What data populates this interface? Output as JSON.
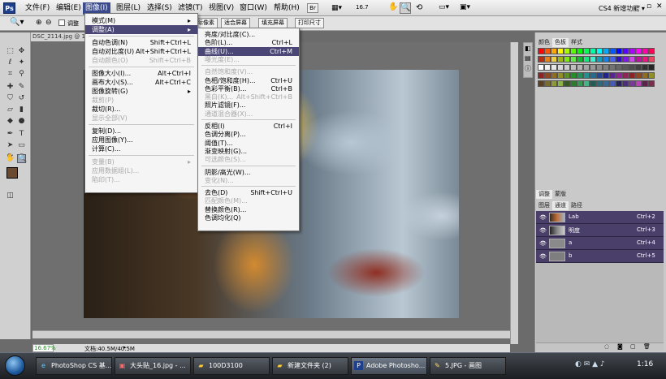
{
  "app": {
    "logo": "Ps",
    "workspace_label": "CS4 新增功能 ▾"
  },
  "menubar": {
    "items": [
      "文件(F)",
      "编辑(E)",
      "图像(I)",
      "图层(L)",
      "选择(S)",
      "滤镜(T)",
      "视图(V)",
      "窗口(W)",
      "帮助(H)"
    ],
    "zoom_readout": "16.7"
  },
  "options_bar": {
    "checkbox_label": "调整",
    "buttons": [
      "实际像素",
      "适合屏幕",
      "填充屏幕",
      "打印尺寸"
    ]
  },
  "document": {
    "tab_title": "DSC_2114.jpg @ 16.7%"
  },
  "status": {
    "zoom": "16.67%",
    "doc_size": "文档:40.5M/40.5M"
  },
  "image_menu": {
    "items": [
      {
        "label": "模式(M)",
        "arrow": "▸",
        "state": "normal"
      },
      {
        "label": "调整(A)",
        "arrow": "▸",
        "state": "highlight"
      },
      {
        "label": "自动色调(N)",
        "shortcut": "Shift+Ctrl+L",
        "state": "normal"
      },
      {
        "label": "自动对比度(U)",
        "shortcut": "Alt+Shift+Ctrl+L",
        "state": "normal"
      },
      {
        "label": "自动颜色(O)",
        "shortcut": "Shift+Ctrl+B",
        "state": "disabled"
      },
      {
        "label": "图像大小(I)...",
        "shortcut": "Alt+Ctrl+I",
        "state": "normal"
      },
      {
        "label": "画布大小(S)...",
        "shortcut": "Alt+Ctrl+C",
        "state": "normal"
      },
      {
        "label": "图像旋转(G)",
        "arrow": "▸",
        "state": "normal"
      },
      {
        "label": "裁剪(P)",
        "state": "disabled"
      },
      {
        "label": "裁切(R)...",
        "state": "normal"
      },
      {
        "label": "显示全部(V)",
        "state": "disabled"
      },
      {
        "label": "复制(D)...",
        "state": "normal"
      },
      {
        "label": "应用图像(Y)...",
        "state": "normal"
      },
      {
        "label": "计算(C)...",
        "state": "normal"
      },
      {
        "label": "变量(B)",
        "arrow": "▸",
        "state": "disabled"
      },
      {
        "label": "应用数据组(L)...",
        "state": "disabled"
      },
      {
        "label": "陷印(T)...",
        "state": "disabled"
      }
    ]
  },
  "adjust_menu": {
    "items": [
      {
        "label": "亮度/对比度(C)...",
        "state": "normal"
      },
      {
        "label": "色阶(L)...",
        "shortcut": "Ctrl+L",
        "state": "normal"
      },
      {
        "label": "曲线(U)...",
        "shortcut": "Ctrl+M",
        "state": "highlight"
      },
      {
        "label": "曝光度(E)...",
        "state": "disabled"
      },
      {
        "label": "自然饱和度(V)...",
        "state": "disabled"
      },
      {
        "label": "色相/饱和度(H)...",
        "shortcut": "Ctrl+U",
        "state": "normal"
      },
      {
        "label": "色彩平衡(B)...",
        "shortcut": "Ctrl+B",
        "state": "normal"
      },
      {
        "label": "黑白(K)...",
        "shortcut": "Alt+Shift+Ctrl+B",
        "state": "disabled"
      },
      {
        "label": "照片滤镜(F)...",
        "state": "normal"
      },
      {
        "label": "通道混合器(X)...",
        "state": "disabled"
      },
      {
        "label": "反相(I)",
        "shortcut": "Ctrl+I",
        "state": "normal"
      },
      {
        "label": "色调分离(P)...",
        "state": "normal"
      },
      {
        "label": "阈值(T)...",
        "state": "normal"
      },
      {
        "label": "渐变映射(G)...",
        "state": "normal"
      },
      {
        "label": "可选颜色(S)...",
        "state": "disabled"
      },
      {
        "label": "阴影/高光(W)...",
        "state": "normal"
      },
      {
        "label": "变化(N)...",
        "state": "disabled"
      },
      {
        "label": "去色(D)",
        "shortcut": "Shift+Ctrl+U",
        "state": "normal"
      },
      {
        "label": "匹配颜色(M)...",
        "state": "disabled"
      },
      {
        "label": "替换颜色(R)...",
        "state": "normal"
      },
      {
        "label": "色调均化(Q)",
        "state": "normal"
      }
    ]
  },
  "swatch_panel": {
    "tabs": [
      "颜色",
      "色板",
      "样式"
    ]
  },
  "adjust_panel": {
    "tabs": [
      "调整",
      "蒙版"
    ]
  },
  "channels_panel": {
    "tabs": [
      "图层",
      "通道",
      "路径"
    ],
    "rows": [
      {
        "name": "Lab",
        "shortcut": "Ctrl+2"
      },
      {
        "name": "明度",
        "shortcut": "Ctrl+3"
      },
      {
        "name": "a",
        "shortcut": "Ctrl+4"
      },
      {
        "name": "b",
        "shortcut": "Ctrl+5"
      }
    ]
  },
  "taskbar": {
    "items": [
      {
        "label": "PhotoShop CS 基...",
        "icon": "ie-icon"
      },
      {
        "label": "大头贴_16.jpg - ...",
        "icon": "picture-icon"
      },
      {
        "label": "100D3100",
        "icon": "folder-icon"
      },
      {
        "label": "新建文件夹 (2)",
        "icon": "folder-icon"
      },
      {
        "label": "Adobe Photosho...",
        "icon": "ps-icon"
      },
      {
        "label": "5.JPG - 画图",
        "icon": "paint-icon"
      }
    ],
    "clock": "1:16"
  },
  "colors": {
    "menu_highlight": "#4a4675",
    "channel_row": "#4a3f6b",
    "foreground_swatch": "#6b4a2e",
    "background_swatch": "#ffffff"
  }
}
